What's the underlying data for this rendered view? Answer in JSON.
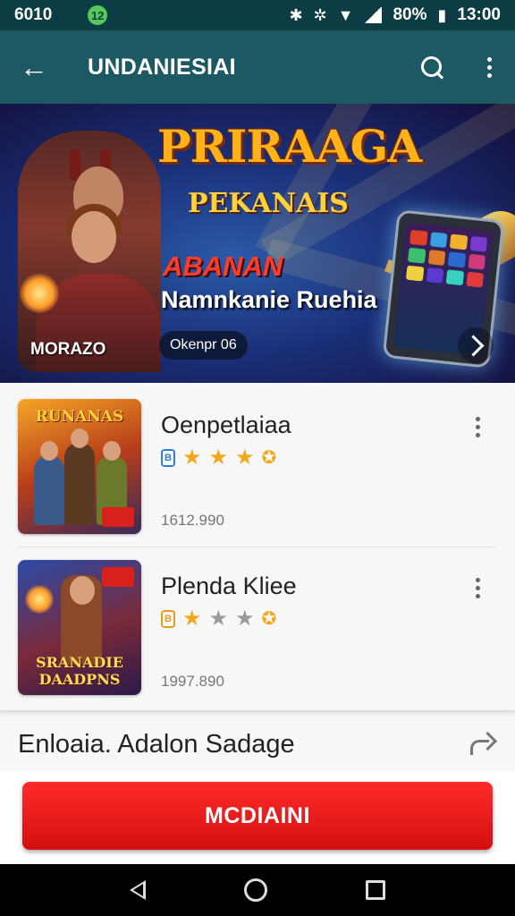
{
  "status_bar": {
    "time": "6010",
    "notification_badge": "12",
    "battery_text": "80%",
    "clock_right": "13:00"
  },
  "app_bar": {
    "title": "UNDANIESIAI",
    "icons": [
      "back-arrow-icon",
      "search-icon",
      "more-vert-icon"
    ]
  },
  "banner": {
    "title": "PRIRAAGA",
    "subtitle": "PEKANAIS",
    "tag": "ABANAN",
    "tagline": "Namnkanie Ruehia",
    "hero_label": "MORAZO",
    "chip": "Okenpr 06"
  },
  "list": [
    {
      "title": "Oenpetlaiaa",
      "meta": "1612.990",
      "thumb_text": "RUNANAS",
      "rating_icon": "B"
    },
    {
      "title": "Plenda Kliee",
      "meta": "1997.890",
      "thumb_text": "SRANADIE DAADPNS",
      "rating_icon": "B"
    }
  ],
  "section": {
    "title": "Enloaia. Adalon Sadage"
  },
  "cta": {
    "label": "MCDIAINI"
  },
  "colors": {
    "status_bar": "#0d3d44",
    "app_bar": "#1c5963",
    "cta": "#e81818",
    "star": "#f1a81c"
  }
}
